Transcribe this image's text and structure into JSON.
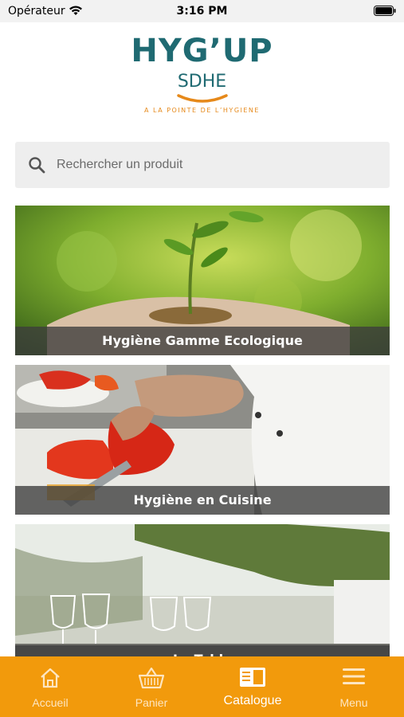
{
  "status": {
    "carrier": "Opérateur",
    "time": "3:16 PM"
  },
  "logo": {
    "main": "HYG’UP",
    "sub": "SDHE",
    "tagline": "A LA POINTE DE L’HYGIENE"
  },
  "search": {
    "placeholder": "Rechercher un produit",
    "value": ""
  },
  "categories": [
    {
      "label": "Hygiène Gamme Ecologique"
    },
    {
      "label": "Hygiène en Cuisine"
    },
    {
      "label": "La Table"
    }
  ],
  "tabs": [
    {
      "label": "Accueil",
      "icon": "home-icon"
    },
    {
      "label": "Panier",
      "icon": "basket-icon"
    },
    {
      "label": "Catalogue",
      "icon": "catalog-icon",
      "active": true
    },
    {
      "label": "Menu",
      "icon": "menu-icon"
    }
  ],
  "colors": {
    "brand_teal": "#1f6a72",
    "brand_orange": "#f29a0c",
    "tagline_orange": "#e6891a"
  }
}
